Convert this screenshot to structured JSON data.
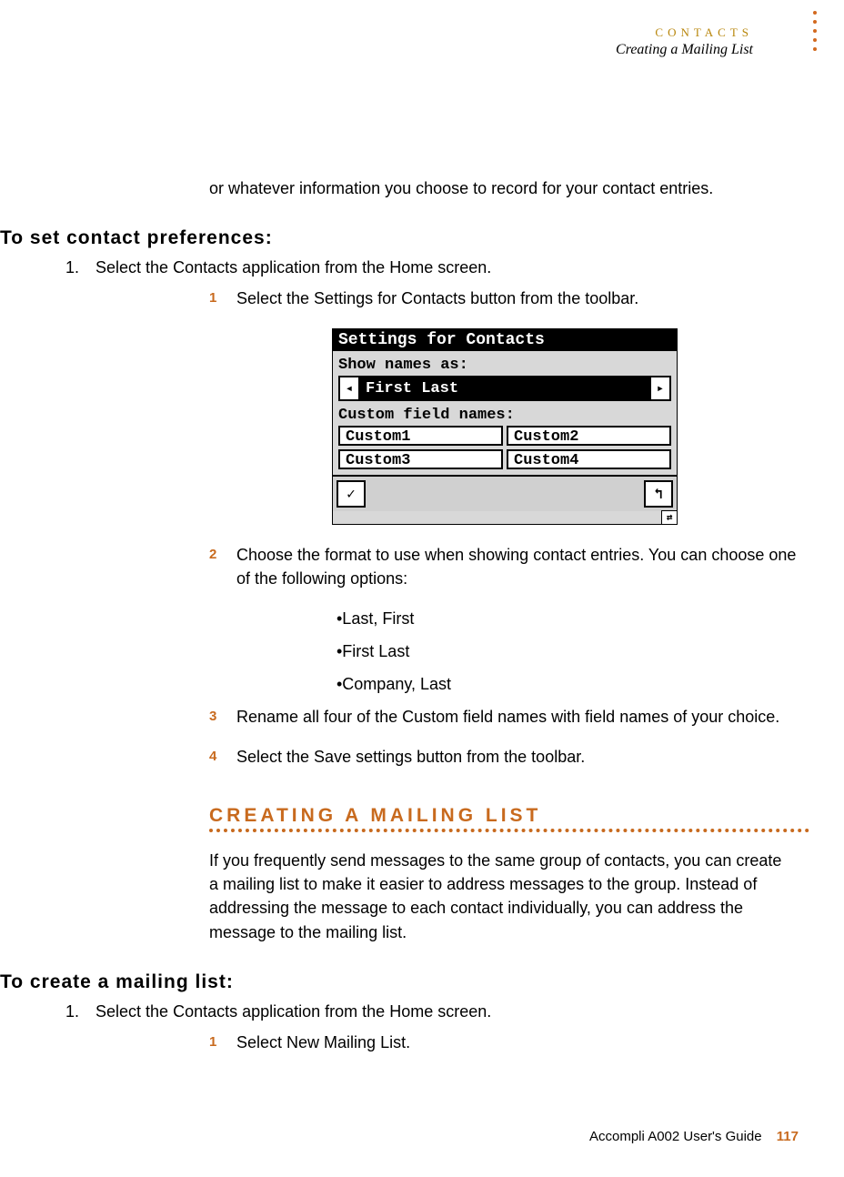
{
  "header": {
    "chapter": "CONTACTS",
    "section": "Creating a Mailing List"
  },
  "intro": "or whatever information you choose to record for your contact entries.",
  "task1": {
    "heading": "To set contact preferences:",
    "outer_num": "1.",
    "outer_text": "Select the Contacts application from the Home screen.",
    "steps": [
      {
        "n": "1",
        "t": "Select the Settings for Contacts button from the toolbar."
      },
      {
        "n": "2",
        "t": "Choose the format to use when showing contact entries. You can choose one of the following options:"
      },
      {
        "n": "3",
        "t": "Rename all four of the Custom field names with field names of your choice."
      },
      {
        "n": "4",
        "t": "Select the Save settings button from the toolbar."
      }
    ],
    "bullets": [
      "•Last, First",
      "•First Last",
      "•Company, Last"
    ]
  },
  "screenshot": {
    "title": "Settings for Contacts",
    "label1": "Show names as:",
    "select_value": "First Last",
    "label2": "Custom field names:",
    "cells": [
      "Custom1",
      "Custom2",
      "Custom3",
      "Custom4"
    ],
    "ok_glyph": "✓",
    "back_glyph": "↰",
    "corner_glyph": "⇄"
  },
  "section2": {
    "heading": "CREATING A MAILING LIST",
    "para": "If you frequently send messages to the same group of contacts, you can create a mailing list to make it easier to address messages to the group. Instead of addressing the message to each contact individually, you can address the message to the mailing list."
  },
  "task2": {
    "heading": "To create a mailing list:",
    "outer_num": "1.",
    "outer_text": "Select the Contacts application from the Home screen.",
    "steps": [
      {
        "n": "1",
        "t": "Select New Mailing List."
      }
    ]
  },
  "footer": {
    "guide": "Accompli A002 User's Guide",
    "page": "117"
  }
}
